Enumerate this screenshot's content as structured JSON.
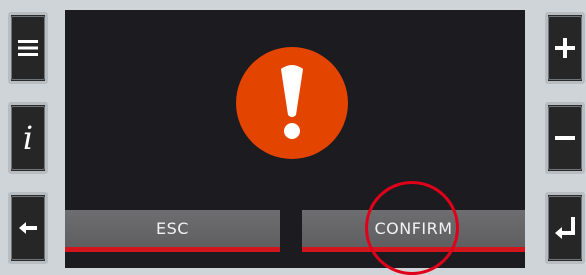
{
  "left_buttons": [
    {
      "name": "menu-button",
      "icon": "menu-icon"
    },
    {
      "name": "info-button",
      "icon": "info-icon",
      "glyph": "i"
    },
    {
      "name": "back-button",
      "icon": "arrow-left-icon"
    }
  ],
  "right_buttons": [
    {
      "name": "plus-button",
      "icon": "plus-icon"
    },
    {
      "name": "minus-button",
      "icon": "minus-icon"
    },
    {
      "name": "enter-button",
      "icon": "enter-icon"
    }
  ],
  "dialog": {
    "icon": "warning-icon",
    "icon_color": "#e34400",
    "esc_label": "ESC",
    "confirm_label": "CONFIRM",
    "underline_color": "#d4141c",
    "highlight_color": "#e0001a"
  }
}
